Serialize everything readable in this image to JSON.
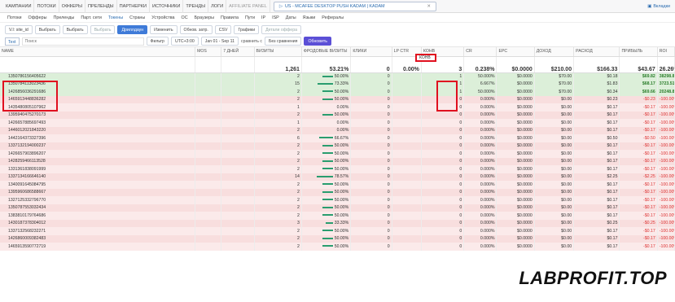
{
  "topnav": {
    "items": [
      "КАМПАНИИ",
      "ПОТОКИ",
      "ОФФЕРЫ",
      "ПРЕЛЕНДЫ",
      "ПАРТНЕРКИ",
      "ИСТОЧНИКИ",
      "ТРЕНДЫ",
      "ЛОГИ"
    ],
    "affiliate_panel": "AFFILIATE PANEL",
    "campaign_tab": "US - MCAFEE DESKTOP PUSH KADAM | KADAM",
    "tabs_label": "Вкладки"
  },
  "groupbar": {
    "items": [
      "Потоки",
      "Офферы",
      "Преленды",
      "Парт. сети",
      "Токены",
      "Страны",
      "Устройства",
      "ОС",
      "Браузеры",
      "Правила",
      "Пути",
      "IP",
      "ISP",
      "Даты",
      "Языки",
      "Рефералы"
    ]
  },
  "filterbar": {
    "group_value": "V.I: site_id",
    "select1": "Выбрать",
    "select2": "Выбрать",
    "select3": "Выбрать",
    "drilldown": "Дриллдаун",
    "edit": "Изменить",
    "update_costs": "Обнов. затр.",
    "csv": "CSV",
    "charts": "Графики",
    "offer_details": "Детали оффера"
  },
  "searchbar": {
    "mode": "Text",
    "placeholder": "Поиск",
    "filter": "Фильтр",
    "timezone": "UTC+3:00",
    "date_range": "Jan 01 - Sep 11",
    "compare_label": "сравнить с",
    "compare_value": "Без сравнения",
    "refresh": "Обновить"
  },
  "table": {
    "headers": [
      "NAME",
      "MOS",
      "7 ДНЕЙ",
      "ВИЗИТЫ",
      "ФРОДОВЫЕ ВИЗИТЫ",
      "КЛИКИ",
      "LP CTR",
      "КОНВ",
      "CR",
      "EPC",
      "ДОХОД",
      "РАСХОД",
      "ПРИБЫЛЬ",
      "ROI"
    ],
    "totals": {
      "visits": "1,261",
      "fraud": "53.21%",
      "clicks": "0",
      "lp_ctr": "0.00%",
      "conv": "3",
      "cr": "0.238%",
      "epc": "$0.0000",
      "revenue": "$210.00",
      "cost": "$166.33",
      "profit": "$43.67",
      "roi": "26.26%"
    },
    "rows": [
      {
        "name": "1350786156405622",
        "visits": "2",
        "fraud": "50.00%",
        "fraud_val": 50,
        "clicks": "0",
        "conv": "1",
        "cr": "50.000%",
        "epc": "$0.0000",
        "revenue": "$70.00",
        "cost": "$0.18",
        "profit": "$69.82",
        "roi": "38298.81%",
        "status": "good"
      },
      {
        "name": "1350784113023436",
        "visits": "15",
        "fraud": "73.33%",
        "fraud_val": 73.33,
        "clicks": "0",
        "conv": "1",
        "cr": "6.667%",
        "epc": "$0.0000",
        "revenue": "$70.00",
        "cost": "$1.83",
        "profit": "$68.17",
        "roi": "3723.51%",
        "status": "good"
      },
      {
        "name": "1426856036291686",
        "visits": "2",
        "fraud": "50.00%",
        "fraud_val": 50,
        "clicks": "0",
        "conv": "1",
        "cr": "50.000%",
        "epc": "$0.0000",
        "revenue": "$70.00",
        "cost": "$0.34",
        "profit": "$69.66",
        "roi": "20248.84%",
        "status": "good"
      },
      {
        "name": "1465913448836282",
        "visits": "2",
        "fraud": "50.00%",
        "fraud_val": 50,
        "clicks": "0",
        "conv": "0",
        "cr": "0.000%",
        "epc": "$0.0000",
        "revenue": "$0.00",
        "cost": "$0.23",
        "profit": "-$0.23",
        "roi": "-100.00%",
        "status": "bad"
      },
      {
        "name": "1435480805107962",
        "visits": "1",
        "fraud": "0.00%",
        "fraud_val": 0,
        "clicks": "0",
        "conv": "0",
        "cr": "0.000%",
        "epc": "$0.0000",
        "revenue": "$0.00",
        "cost": "$0.17",
        "profit": "-$0.17",
        "roi": "-100.00%",
        "status": "bad"
      },
      {
        "name": "1395940475270173",
        "visits": "2",
        "fraud": "50.00%",
        "fraud_val": 50,
        "clicks": "0",
        "conv": "0",
        "cr": "0.000%",
        "epc": "$0.0000",
        "revenue": "$0.00",
        "cost": "$0.17",
        "profit": "-$0.17",
        "roi": "-100.00%",
        "status": "bad"
      },
      {
        "name": "1426657885697493",
        "visits": "1",
        "fraud": "0.00%",
        "fraud_val": 0,
        "clicks": "0",
        "conv": "0",
        "cr": "0.000%",
        "epc": "$0.0000",
        "revenue": "$0.00",
        "cost": "$0.17",
        "profit": "-$0.17",
        "roi": "-100.00%",
        "status": "bad"
      },
      {
        "name": "1446012021843220",
        "visits": "2",
        "fraud": "0.00%",
        "fraud_val": 0,
        "clicks": "0",
        "conv": "0",
        "cr": "0.000%",
        "epc": "$0.0000",
        "revenue": "$0.00",
        "cost": "$0.17",
        "profit": "-$0.17",
        "roi": "-100.00%",
        "status": "bad"
      },
      {
        "name": "1442164373327396",
        "visits": "6",
        "fraud": "66.67%",
        "fraud_val": 66.67,
        "clicks": "0",
        "conv": "0",
        "cr": "0.000%",
        "epc": "$0.0000",
        "revenue": "$0.00",
        "cost": "$0.50",
        "profit": "-$0.50",
        "roi": "-100.00%",
        "status": "bad"
      },
      {
        "name": "1337132194000237",
        "visits": "2",
        "fraud": "50.00%",
        "fraud_val": 50,
        "clicks": "0",
        "conv": "0",
        "cr": "0.000%",
        "epc": "$0.0000",
        "revenue": "$0.00",
        "cost": "$0.17",
        "profit": "-$0.17",
        "roi": "-100.00%",
        "status": "bad"
      },
      {
        "name": "1426657903896207",
        "visits": "2",
        "fraud": "50.00%",
        "fraud_val": 50,
        "clicks": "0",
        "conv": "0",
        "cr": "0.000%",
        "epc": "$0.0000",
        "revenue": "$0.00",
        "cost": "$0.17",
        "profit": "-$0.17",
        "roi": "-100.00%",
        "status": "bad"
      },
      {
        "name": "1428259466113528",
        "visits": "2",
        "fraud": "50.00%",
        "fraud_val": 50,
        "clicks": "0",
        "conv": "0",
        "cr": "0.000%",
        "epc": "$0.0000",
        "revenue": "$0.00",
        "cost": "$0.17",
        "profit": "-$0.17",
        "roi": "-100.00%",
        "status": "bad"
      },
      {
        "name": "1331361838091999",
        "visits": "2",
        "fraud": "50.00%",
        "fraud_val": 50,
        "clicks": "0",
        "conv": "0",
        "cr": "0.000%",
        "epc": "$0.0000",
        "revenue": "$0.00",
        "cost": "$0.17",
        "profit": "-$0.17",
        "roi": "-100.00%",
        "status": "bad"
      },
      {
        "name": "1337134166646140",
        "visits": "14",
        "fraud": "78.57%",
        "fraud_val": 78.57,
        "clicks": "0",
        "conv": "0",
        "cr": "0.000%",
        "epc": "$0.0000",
        "revenue": "$0.00",
        "cost": "$2.25",
        "profit": "-$2.25",
        "roi": "-100.00%",
        "status": "bad"
      },
      {
        "name": "1340091645084795",
        "visits": "2",
        "fraud": "50.00%",
        "fraud_val": 50,
        "clicks": "0",
        "conv": "0",
        "cr": "0.000%",
        "epc": "$0.0000",
        "revenue": "$0.00",
        "cost": "$0.17",
        "profit": "-$0.17",
        "roi": "-100.00%",
        "status": "bad"
      },
      {
        "name": "1395960686588667",
        "visits": "2",
        "fraud": "50.00%",
        "fraud_val": 50,
        "clicks": "0",
        "conv": "0",
        "cr": "0.000%",
        "epc": "$0.0000",
        "revenue": "$0.00",
        "cost": "$0.17",
        "profit": "-$0.17",
        "roi": "-100.00%",
        "status": "bad"
      },
      {
        "name": "1327125332796770",
        "visits": "2",
        "fraud": "50.00%",
        "fraud_val": 50,
        "clicks": "0",
        "conv": "0",
        "cr": "0.000%",
        "epc": "$0.0000",
        "revenue": "$0.00",
        "cost": "$0.17",
        "profit": "-$0.17",
        "roi": "-100.00%",
        "status": "bad"
      },
      {
        "name": "1350787553032434",
        "visits": "2",
        "fraud": "50.00%",
        "fraud_val": 50,
        "clicks": "0",
        "conv": "0",
        "cr": "0.000%",
        "epc": "$0.0000",
        "revenue": "$0.00",
        "cost": "$0.17",
        "profit": "-$0.17",
        "roi": "-100.00%",
        "status": "bad"
      },
      {
        "name": "1383810179764686",
        "visits": "2",
        "fraud": "50.00%",
        "fraud_val": 50,
        "clicks": "0",
        "conv": "0",
        "cr": "0.000%",
        "epc": "$0.0000",
        "revenue": "$0.00",
        "cost": "$0.17",
        "profit": "-$0.17",
        "roi": "-100.00%",
        "status": "bad"
      },
      {
        "name": "1430187378304012",
        "visits": "3",
        "fraud": "33.33%",
        "fraud_val": 33.33,
        "clicks": "0",
        "conv": "0",
        "cr": "0.000%",
        "epc": "$0.0000",
        "revenue": "$0.00",
        "cost": "$0.25",
        "profit": "-$0.25",
        "roi": "-100.00%",
        "status": "bad"
      },
      {
        "name": "1337132568232271",
        "visits": "2",
        "fraud": "50.00%",
        "fraud_val": 50,
        "clicks": "0",
        "conv": "0",
        "cr": "0.000%",
        "epc": "$0.0000",
        "revenue": "$0.00",
        "cost": "$0.17",
        "profit": "-$0.17",
        "roi": "-100.00%",
        "status": "bad"
      },
      {
        "name": "1426860009382483",
        "visits": "2",
        "fraud": "50.00%",
        "fraud_val": 50,
        "clicks": "0",
        "conv": "0",
        "cr": "0.000%",
        "epc": "$0.0000",
        "revenue": "$0.00",
        "cost": "$0.17",
        "profit": "-$0.17",
        "roi": "-100.00%",
        "status": "bad"
      },
      {
        "name": "1465913590772719",
        "visits": "2",
        "fraud": "50.00%",
        "fraud_val": 50,
        "clicks": "0",
        "conv": "0",
        "cr": "0.000%",
        "epc": "$0.0000",
        "revenue": "$0.00",
        "cost": "$0.17",
        "profit": "-$0.17",
        "roi": "-100.00%",
        "status": "bad"
      }
    ]
  },
  "watermark": "LABPROFIT.TOP",
  "colors": {
    "good_row": "#dcefd9",
    "bad_row": "#fbeaea",
    "highlight_box": "#e0101f",
    "accent": "#3f7bd8"
  }
}
